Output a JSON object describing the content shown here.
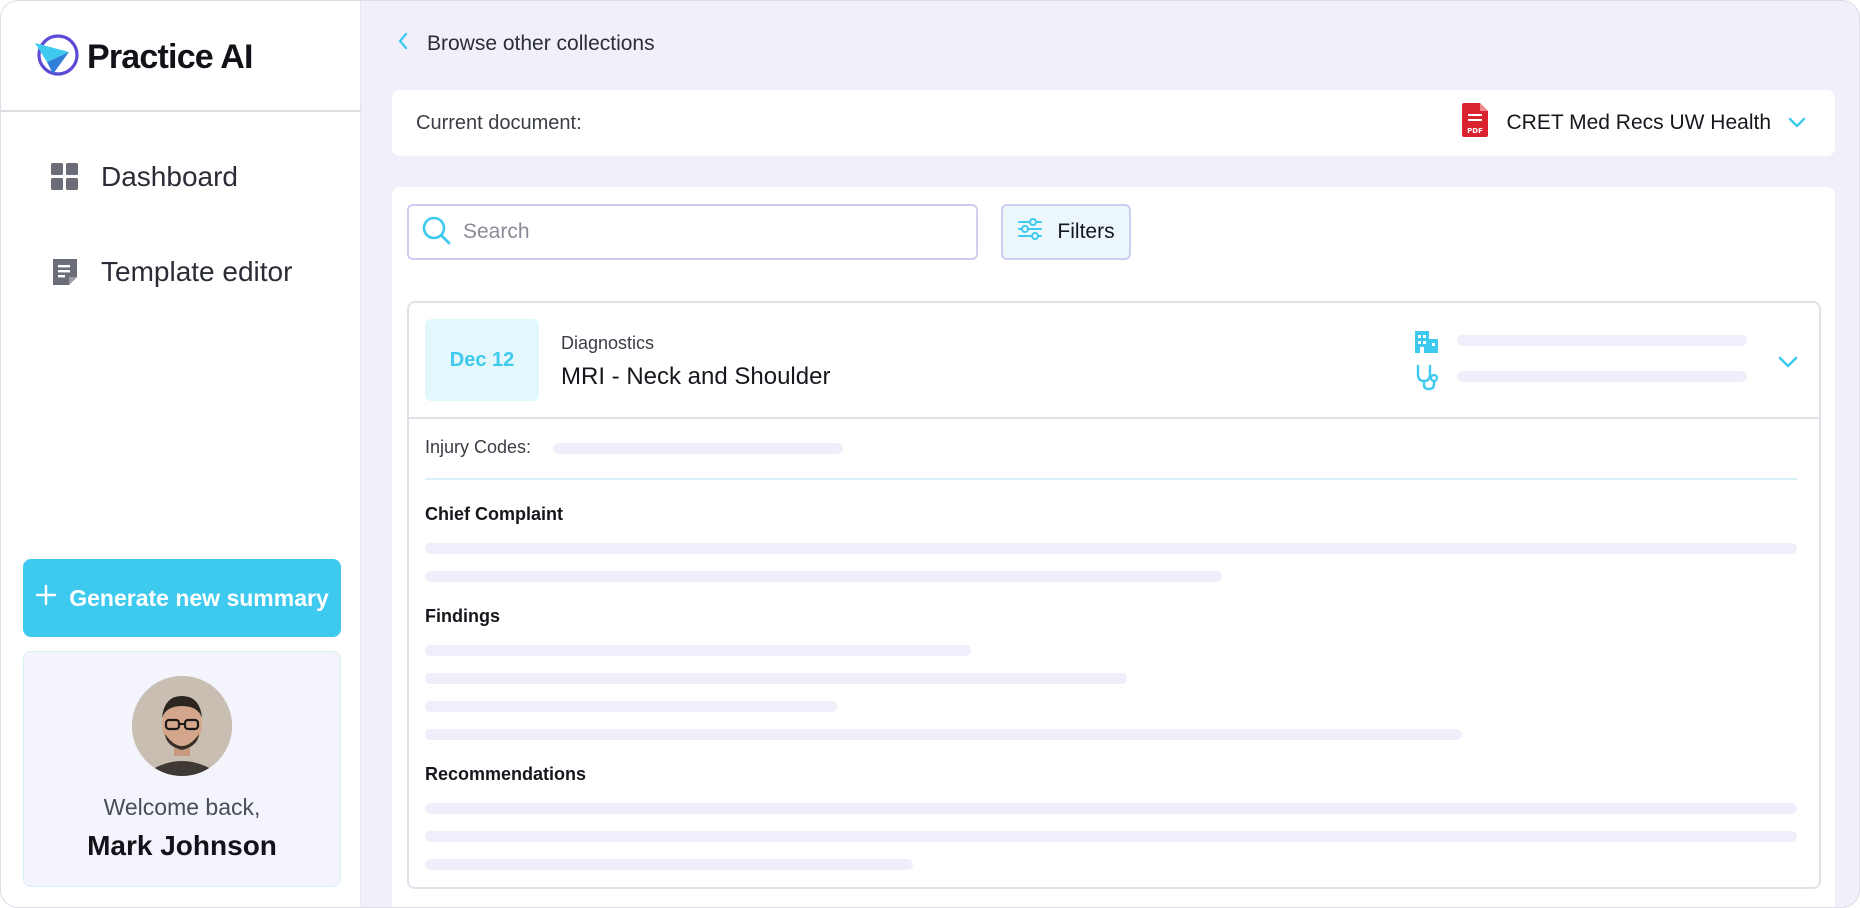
{
  "brand": {
    "name": "Practice AI"
  },
  "nav": {
    "items": [
      {
        "label": "Dashboard",
        "icon": "dashboard-grid-icon"
      },
      {
        "label": "Template editor",
        "icon": "document-edit-icon"
      }
    ]
  },
  "actions": {
    "generate_label": "Generate new summary"
  },
  "user": {
    "welcome": "Welcome back,",
    "name": "Mark Johnson"
  },
  "header": {
    "back_label": "Browse other collections"
  },
  "document": {
    "label": "Current document:",
    "selected": "CRET Med Recs UW Health",
    "file_type": "PDF"
  },
  "search": {
    "placeholder": "Search",
    "value": ""
  },
  "filters": {
    "label": "Filters"
  },
  "record": {
    "date": "Dec 12",
    "category": "Diagnostics",
    "title": "MRI - Neck and Shoulder",
    "injury_label": "Injury Codes:",
    "sections": [
      "Chief Complaint",
      "Findings",
      "Recommendations"
    ]
  },
  "colors": {
    "accent": "#3ec9ef",
    "background": "#f1f0fa",
    "skeleton": "#efeefa",
    "pdf_red": "#d9232e",
    "brand_purple": "#5b4bd6"
  }
}
